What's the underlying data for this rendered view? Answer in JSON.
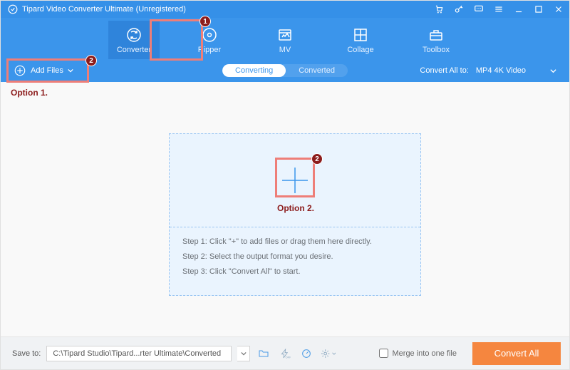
{
  "titlebar": {
    "title": "Tipard Video Converter Ultimate (Unregistered)"
  },
  "tabs": {
    "items": [
      {
        "label": "Converter"
      },
      {
        "label": "Ripper"
      },
      {
        "label": "MV"
      },
      {
        "label": "Collage"
      },
      {
        "label": "Toolbox"
      }
    ]
  },
  "toolbar": {
    "add_files_label": "Add Files",
    "subtabs": {
      "converting": "Converting",
      "converted": "Converted"
    },
    "convert_all_to_label": "Convert All to:",
    "convert_all_to_value": "MP4 4K Video"
  },
  "dropzone": {
    "step1": "Step 1: Click \"+\" to add files or drag them here directly.",
    "step2": "Step 2: Select the output format you desire.",
    "step3": "Step 3: Click \"Convert All\" to start."
  },
  "footer": {
    "save_to_label": "Save to:",
    "save_to_path": "C:\\Tipard Studio\\Tipard...rter Ultimate\\Converted",
    "merge_label": "Merge into one file",
    "convert_all_label": "Convert All"
  },
  "annotations": {
    "option1_label": "Option 1.",
    "option2_label": "Option 2.",
    "badge1": "1",
    "badge2": "2"
  }
}
